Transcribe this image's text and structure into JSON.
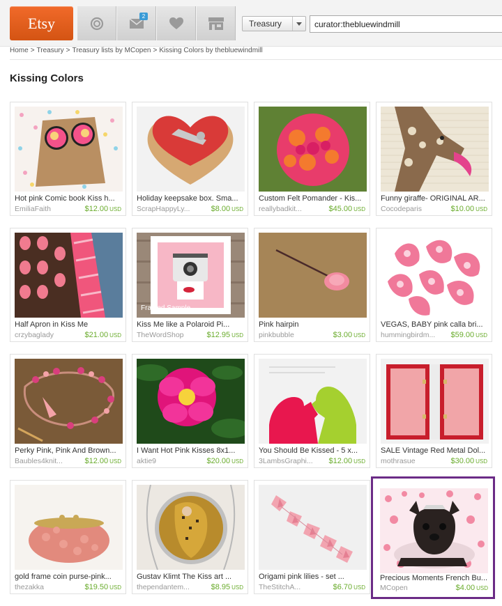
{
  "header": {
    "logo": "Etsy",
    "nav": {
      "messages_badge": "2"
    },
    "search": {
      "category": "Treasury",
      "query": "curator:thebluewindmill"
    }
  },
  "breadcrumb": [
    "Home",
    "Treasury",
    "Treasury lists by MCopen",
    "Kissing Colors by thebluewindmill"
  ],
  "page_title": "Kissing Colors",
  "currency": "USD",
  "colors": {
    "price_green": "#6aac2d",
    "highlight_border": "#6b2b86",
    "etsy_orange": "#e55d1a"
  },
  "items": [
    {
      "title": "Hot pink Comic book Kiss h...",
      "shop": "EmiliaFaith",
      "price": "$12.00",
      "thumb": "polka-dot-earrings"
    },
    {
      "title": "Holiday keepsake box. Sma...",
      "shop": "ScrapHappyLy...",
      "price": "$8.00",
      "thumb": "red-heart-box"
    },
    {
      "title": "Custom Felt Pomander - Kis...",
      "shop": "reallybadkit...",
      "price": "$45.00",
      "thumb": "felt-pomander"
    },
    {
      "title": "Funny giraffe- ORIGINAL AR...",
      "shop": "Cocodeparis",
      "price": "$10.00",
      "thumb": "giraffe-print"
    },
    {
      "title": "Half Apron in Kiss Me",
      "shop": "crzybaglady",
      "price": "$21.00",
      "thumb": "owl-apron"
    },
    {
      "title": "Kiss Me like a Polaroid Pi...",
      "shop": "TheWordShop",
      "price": "$12.95",
      "thumb": "polaroid-print",
      "overlay": "Framed Sample"
    },
    {
      "title": "Pink hairpin",
      "shop": "pinkbubble",
      "price": "$3.00",
      "thumb": "pink-hairpin"
    },
    {
      "title": "VEGAS, BABY pink calla bri...",
      "shop": "hummingbirdm...",
      "price": "$59.00",
      "thumb": "calla-lilies"
    },
    {
      "title": "Perky Pink, Pink And Brown...",
      "shop": "Baubles4knit...",
      "price": "$12.00",
      "thumb": "beaded-bracelet"
    },
    {
      "title": "I Want Hot Pink Kisses 8x1...",
      "shop": "aktie9",
      "price": "$20.00",
      "thumb": "pink-peony"
    },
    {
      "title": "You Should Be Kissed - 5 x...",
      "shop": "3LambsGraphi...",
      "price": "$12.00",
      "thumb": "kiss-silhouette"
    },
    {
      "title": "SALE Vintage Red Metal Dol...",
      "shop": "mothrasue",
      "price": "$30.00",
      "thumb": "doll-case"
    },
    {
      "title": "gold frame coin purse-pink...",
      "shop": "thezakka",
      "price": "$19.50",
      "thumb": "coin-purse"
    },
    {
      "title": "Gustav Klimt The Kiss art ...",
      "shop": "thependantem...",
      "price": "$8.95",
      "thumb": "klimt-pendant"
    },
    {
      "title": "Origami pink lilies - set ...",
      "shop": "TheStitchA...",
      "price": "$6.70",
      "thumb": "origami-lilies"
    },
    {
      "title": "Precious Moments French Bu...",
      "shop": "MCopen",
      "price": "$4.00",
      "thumb": "french-bulldog",
      "highlighted": true
    }
  ]
}
